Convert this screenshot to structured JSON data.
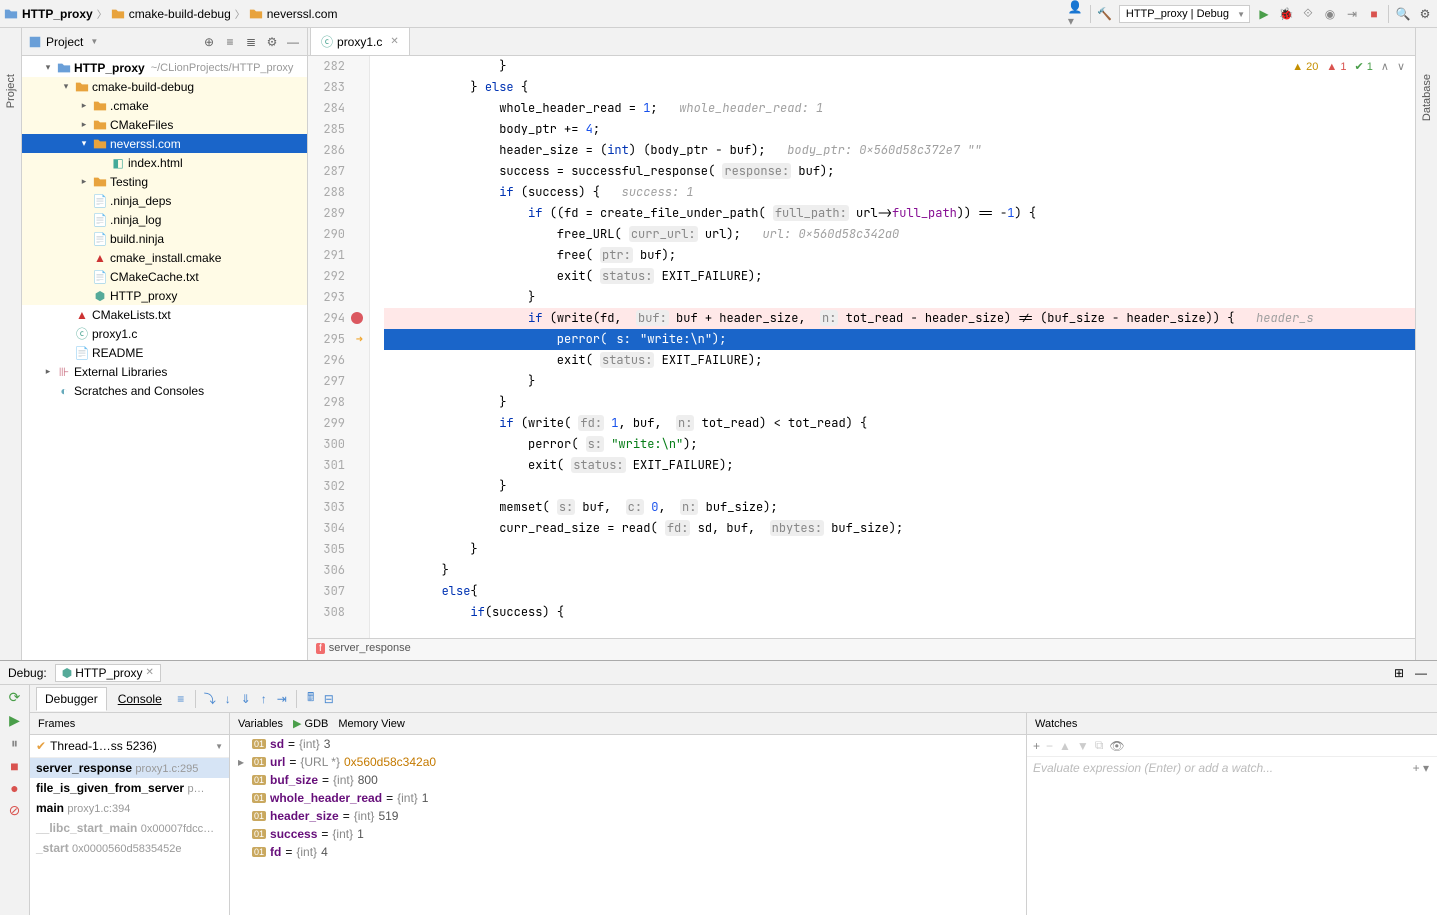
{
  "breadcrumb": {
    "root": "HTTP_proxy",
    "mid": "cmake-build-debug",
    "leaf": "neverssl.com"
  },
  "run_config": "HTTP_proxy | Debug",
  "project_panel_title": "Project",
  "tree": {
    "root_name": "HTTP_proxy",
    "root_path": "~/CLionProjects/HTTP_proxy",
    "build_dir": "cmake-build-debug",
    "cmake_dir": ".cmake",
    "cmakefiles": "CMakeFiles",
    "selected": "neverssl.com",
    "index_html": "index.html",
    "testing": "Testing",
    "ninja_deps": ".ninja_deps",
    "ninja_log": ".ninja_log",
    "build_ninja": "build.ninja",
    "cmake_install": "cmake_install.cmake",
    "cmakecache": "CMakeCache.txt",
    "http_proxy_bin": "HTTP_proxy",
    "cmakelists": "CMakeLists.txt",
    "proxy1": "proxy1.c",
    "readme": "README",
    "extlib": "External Libraries",
    "scratches": "Scratches and Consoles"
  },
  "editor": {
    "tab": "proxy1.c",
    "first_line": 282,
    "footer_func": "server_response",
    "inspect": {
      "warn": "20",
      "err": "1",
      "ok": "1"
    },
    "lines": [
      {
        "n": 282,
        "html": "                }"
      },
      {
        "n": 283,
        "html": "            } <span class='kw'>else</span> {"
      },
      {
        "n": 284,
        "html": "                whole_header_read = <span class='num'>1</span>;   <span class='hint'>whole_header_read: 1</span>"
      },
      {
        "n": 285,
        "html": "                body_ptr += <span class='num'>4</span>;"
      },
      {
        "n": 286,
        "html": "                header_size = (<span class='kw'>int</span>) (body_ptr - buf);   <span class='hint'>body_ptr: 0x560d58c372e7 \"\"</span>"
      },
      {
        "n": 287,
        "html": "                success = successful_response( <span class='prm'>response:</span> buf);"
      },
      {
        "n": 288,
        "html": "                <span class='kw'>if</span> (success) {   <span class='hint'>success: 1</span>"
      },
      {
        "n": 289,
        "html": "                    <span class='kw'>if</span> ((fd = create_file_under_path( <span class='prm'>full_path:</span> url-&gt;<span class='fld'>full_path</span>)) == -<span class='num'>1</span>) {"
      },
      {
        "n": 290,
        "html": "                        free_URL( <span class='prm'>curr_url:</span> url);   <span class='hint'>url: 0x560d58c342a0</span>"
      },
      {
        "n": 291,
        "html": "                        free( <span class='prm'>ptr:</span> buf);"
      },
      {
        "n": 292,
        "html": "                        exit( <span class='prm'>status:</span> EXIT_FAILURE);"
      },
      {
        "n": 293,
        "html": "                    }"
      },
      {
        "n": 294,
        "bp": true,
        "html": "                    <span class='kw'>if</span> (write(fd,  <span class='prm'>buf:</span> buf + header_size,  <span class='prm'>n:</span> tot_read - header_size) != (buf_size - header_size)) {   <span class='hint'>header_s</span>"
      },
      {
        "n": 295,
        "exec": true,
        "html": "                        perror( <span class='prm'>s:</span> <span class='str'>\"write:\\n\"</span>);"
      },
      {
        "n": 296,
        "html": "                        exit( <span class='prm'>status:</span> EXIT_FAILURE);"
      },
      {
        "n": 297,
        "html": "                    }"
      },
      {
        "n": 298,
        "html": "                }"
      },
      {
        "n": 299,
        "html": "                <span class='kw'>if</span> (write( <span class='prm'>fd:</span> <span class='num'>1</span>, buf,  <span class='prm'>n:</span> tot_read) &lt; tot_read) {"
      },
      {
        "n": 300,
        "html": "                    perror( <span class='prm'>s:</span> <span class='str'>\"write:\\n\"</span>);"
      },
      {
        "n": 301,
        "html": "                    exit( <span class='prm'>status:</span> EXIT_FAILURE);"
      },
      {
        "n": 302,
        "html": "                }"
      },
      {
        "n": 303,
        "html": "                memset( <span class='prm'>s:</span> buf,  <span class='prm'>c:</span> <span class='num'>0</span>,  <span class='prm'>n:</span> buf_size);"
      },
      {
        "n": 304,
        "html": "                curr_read_size = read( <span class='prm'>fd:</span> sd, buf,  <span class='prm'>nbytes:</span> buf_size);"
      },
      {
        "n": 305,
        "html": "            }"
      },
      {
        "n": 306,
        "html": "        }"
      },
      {
        "n": 307,
        "html": "        <span class='kw'>else</span>{"
      },
      {
        "n": 308,
        "html": "            <span class='kw'>if</span>(success) {"
      }
    ]
  },
  "debug": {
    "title_prefix": "Debug:",
    "config": "HTTP_proxy",
    "tabs": {
      "debugger": "Debugger",
      "console": "Console",
      "gdb": "GDB",
      "memview": "Memory View"
    },
    "frames_label": "Frames",
    "vars_label": "Variables",
    "watches_label": "Watches",
    "thread": "Thread-1…ss 5236)",
    "frames": [
      {
        "name": "server_response",
        "loc": "proxy1.c:295",
        "active": true
      },
      {
        "name": "file_is_given_from_server",
        "loc": "p…"
      },
      {
        "name": "main",
        "loc": "proxy1.c:394"
      },
      {
        "name": "__libc_start_main",
        "loc": "0x00007fdcc…",
        "dim": true
      },
      {
        "name": "_start",
        "loc": "0x0000560d5835452e",
        "dim": true
      }
    ],
    "vars": [
      {
        "name": "sd",
        "type": "{int}",
        "val": "3"
      },
      {
        "name": "url",
        "type": "{URL *}",
        "val": "0x560d58c342a0",
        "expandable": true,
        "addr": true
      },
      {
        "name": "buf_size",
        "type": "{int}",
        "val": "800"
      },
      {
        "name": "whole_header_read",
        "type": "{int}",
        "val": "1"
      },
      {
        "name": "header_size",
        "type": "{int}",
        "val": "519"
      },
      {
        "name": "success",
        "type": "{int}",
        "val": "1"
      },
      {
        "name": "fd",
        "type": "{int}",
        "val": "4"
      }
    ],
    "watch_placeholder": "Evaluate expression (Enter) or add a watch..."
  },
  "rails": {
    "left": "Project",
    "right": "Database"
  }
}
